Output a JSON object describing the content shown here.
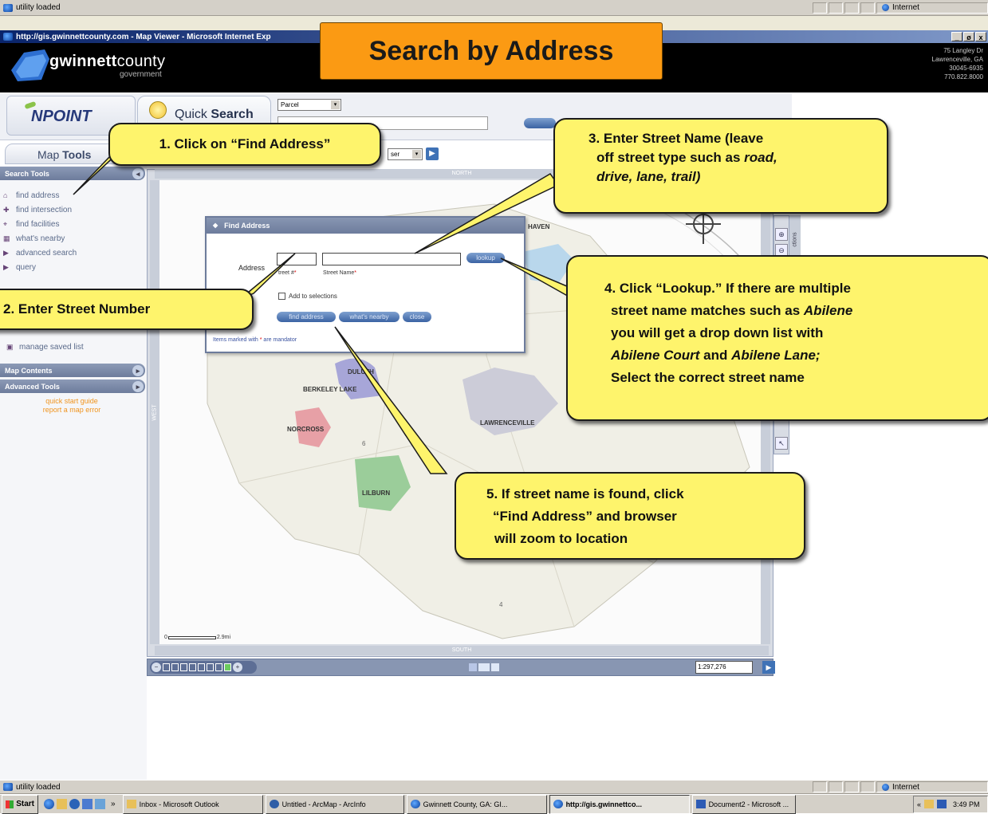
{
  "status_top": {
    "text": "utility loaded",
    "zone": "Internet"
  },
  "window": {
    "title": "http://gis.gwinnettcounty.com - Map Viewer - Microsoft Internet Exp",
    "controls": [
      "_",
      "ø",
      "x"
    ]
  },
  "header": {
    "brand_main": "gwinnett",
    "brand_bold": "county",
    "brand_sub": "government",
    "address_lines": [
      "75 Langley Dr",
      "Lawrenceville, GA",
      "30045-6935",
      "770.822.8000"
    ]
  },
  "banner_title": "Search by Address",
  "quicksearch": {
    "logo": "NPOINT",
    "label_a": "Quick ",
    "label_b": "Search",
    "select_value": "Parcel"
  },
  "maptools": {
    "title_a": "Map ",
    "title_b": "Tools",
    "select_value": "ser",
    "search_tools_header": "Search Tools",
    "items": [
      "find address",
      "find intersection",
      "find facilities",
      "what's nearby",
      "advanced search",
      "query"
    ],
    "manage_saved": "manage saved list",
    "map_contents": "Map Contents",
    "advanced_tools": "Advanced Tools",
    "links": [
      "quick start guide",
      "report a map error"
    ]
  },
  "map": {
    "north": "NORTH",
    "south": "SOUTH",
    "west": "WEST",
    "side_tab": "ctions",
    "cities": [
      "HAVEN",
      "DULUTH",
      "BERKELEY LAKE",
      "NORCROSS",
      "LAWRENCEVILLE",
      "LILBURN"
    ],
    "district_numbers": [
      "6",
      "4"
    ],
    "scale_bar": "2.9mi",
    "scale_start": "0",
    "scale_prefix": "1:",
    "scale_value": "297,276"
  },
  "dialog": {
    "title": "Find Address",
    "address_label": "Address",
    "street_no_label": "treet #",
    "street_name_label": "Street Name",
    "lookup": "lookup",
    "add_selections": "Add to selections",
    "find_address_btn": "find address",
    "whats_nearby_btn": "what's nearby",
    "close_btn": "close",
    "note_a": "Items marked with ",
    "note_star": "*",
    "note_b": " are mandator"
  },
  "callouts": {
    "c1": "1. Click on “Find Address”",
    "c2": "2. Enter Street Number",
    "c3": {
      "l1": "3. Enter Street Name (leave",
      "l2": "off street type such as ",
      "l2i": "road,",
      "l3i": "drive, lane, trail)"
    },
    "c4": {
      "l1": "4. Click “Lookup.” If there are multiple",
      "l2": "street name matches such as ",
      "l2i": "Abilene",
      "l3": "you will get a drop down list with",
      "l4i": "Abilene Court",
      "l4": " and ",
      "l4i2": "Abilene Lane;",
      "l5": "Select the correct street name"
    },
    "c5": {
      "l1": "5. If street name is found, click",
      "l2": "“Find Address” and browser",
      "l3": "will zoom to location"
    }
  },
  "status_bottom": {
    "text": "utility loaded",
    "zone": "Internet"
  },
  "taskbar": {
    "start": "Start",
    "chevron": "»",
    "tasks": [
      "Inbox - Microsoft Outlook",
      "Untitled - ArcMap - ArcInfo",
      "Gwinnett County, GA: GI...",
      "http://gis.gwinnettco...",
      "Document2 - Microsoft ..."
    ],
    "tray_chevron": "«",
    "clock": "3:49 PM"
  }
}
